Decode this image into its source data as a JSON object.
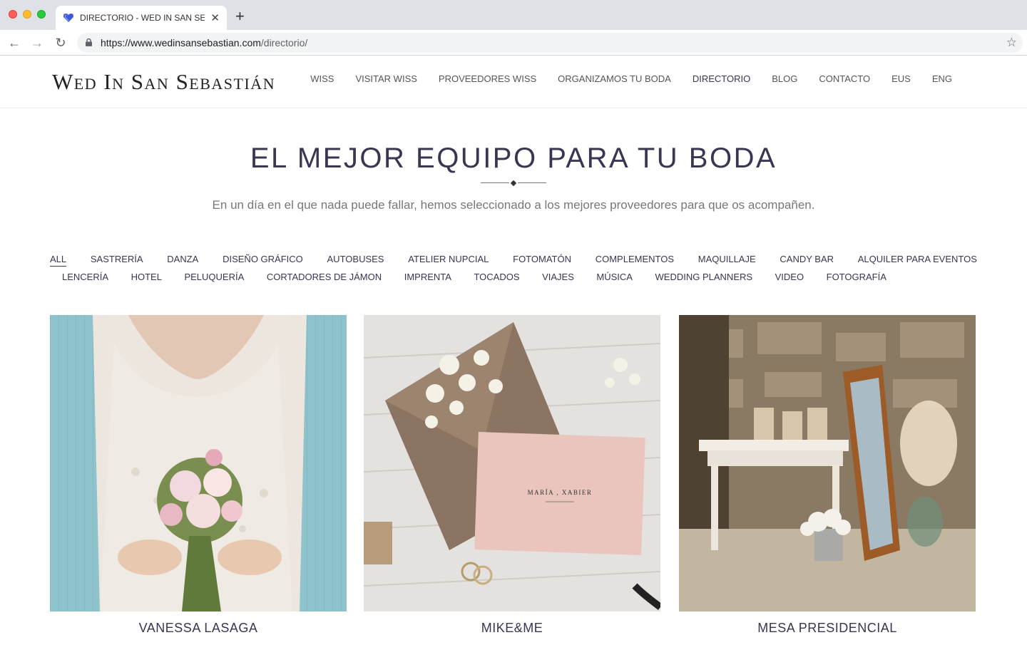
{
  "browser": {
    "tab_title": "DIRECTORIO - WED IN SAN SEBASTIÁN",
    "new_tab_label": "+",
    "url_main": "https://www.wedinsansebastian.com",
    "url_path": "/directorio/",
    "icons": [
      "back-icon",
      "forward-icon",
      "reload-icon",
      "lock-icon",
      "star-icon",
      "close-icon"
    ]
  },
  "header": {
    "logo": "Wed In San Sebastián",
    "nav": [
      {
        "label": "WISS"
      },
      {
        "label": "VISITAR WISS"
      },
      {
        "label": "PROVEEDORES WISS"
      },
      {
        "label": "ORGANIZAMOS TU BODA"
      },
      {
        "label": "DIRECTORIO"
      },
      {
        "label": "BLOG"
      },
      {
        "label": "CONTACTO"
      },
      {
        "label": "EUS"
      },
      {
        "label": "ENG"
      }
    ]
  },
  "hero": {
    "title": "EL MEJOR EQUIPO PARA TU BODA",
    "subtitle": "En un día en el que nada puede fallar, hemos seleccionado a los mejores proveedores para que os acompañen."
  },
  "filters": {
    "row1": [
      "ALL",
      "SASTRERÍA",
      "DANZA",
      "DISEÑO GRÁFICO",
      "AUTOBUSES",
      "ATELIER NUPCIAL",
      "FOTOMATÓN",
      "COMPLEMENTOS",
      "MAQUILLAJE",
      "CANDY BAR",
      "ALQUILER PARA EVENTOS"
    ],
    "row2": [
      "LENCERÍA",
      "HOTEL",
      "PELUQUERÍA",
      "CORTADORES DE JÁMON",
      "IMPRENTA",
      "TOCADOS",
      "VIAJES",
      "MÚSICA",
      "WEDDING PLANNERS",
      "VIDEO",
      "FOTOGRAFÍA"
    ]
  },
  "cards": [
    {
      "name": "VANESSA LASAGA"
    },
    {
      "name": "MIKE&ME",
      "invite_names": "MARÍA , XABIER"
    },
    {
      "name": "MESA PRESIDENCIAL"
    }
  ],
  "colors": {
    "accent": "#3a3550",
    "text_muted": "#777777"
  }
}
